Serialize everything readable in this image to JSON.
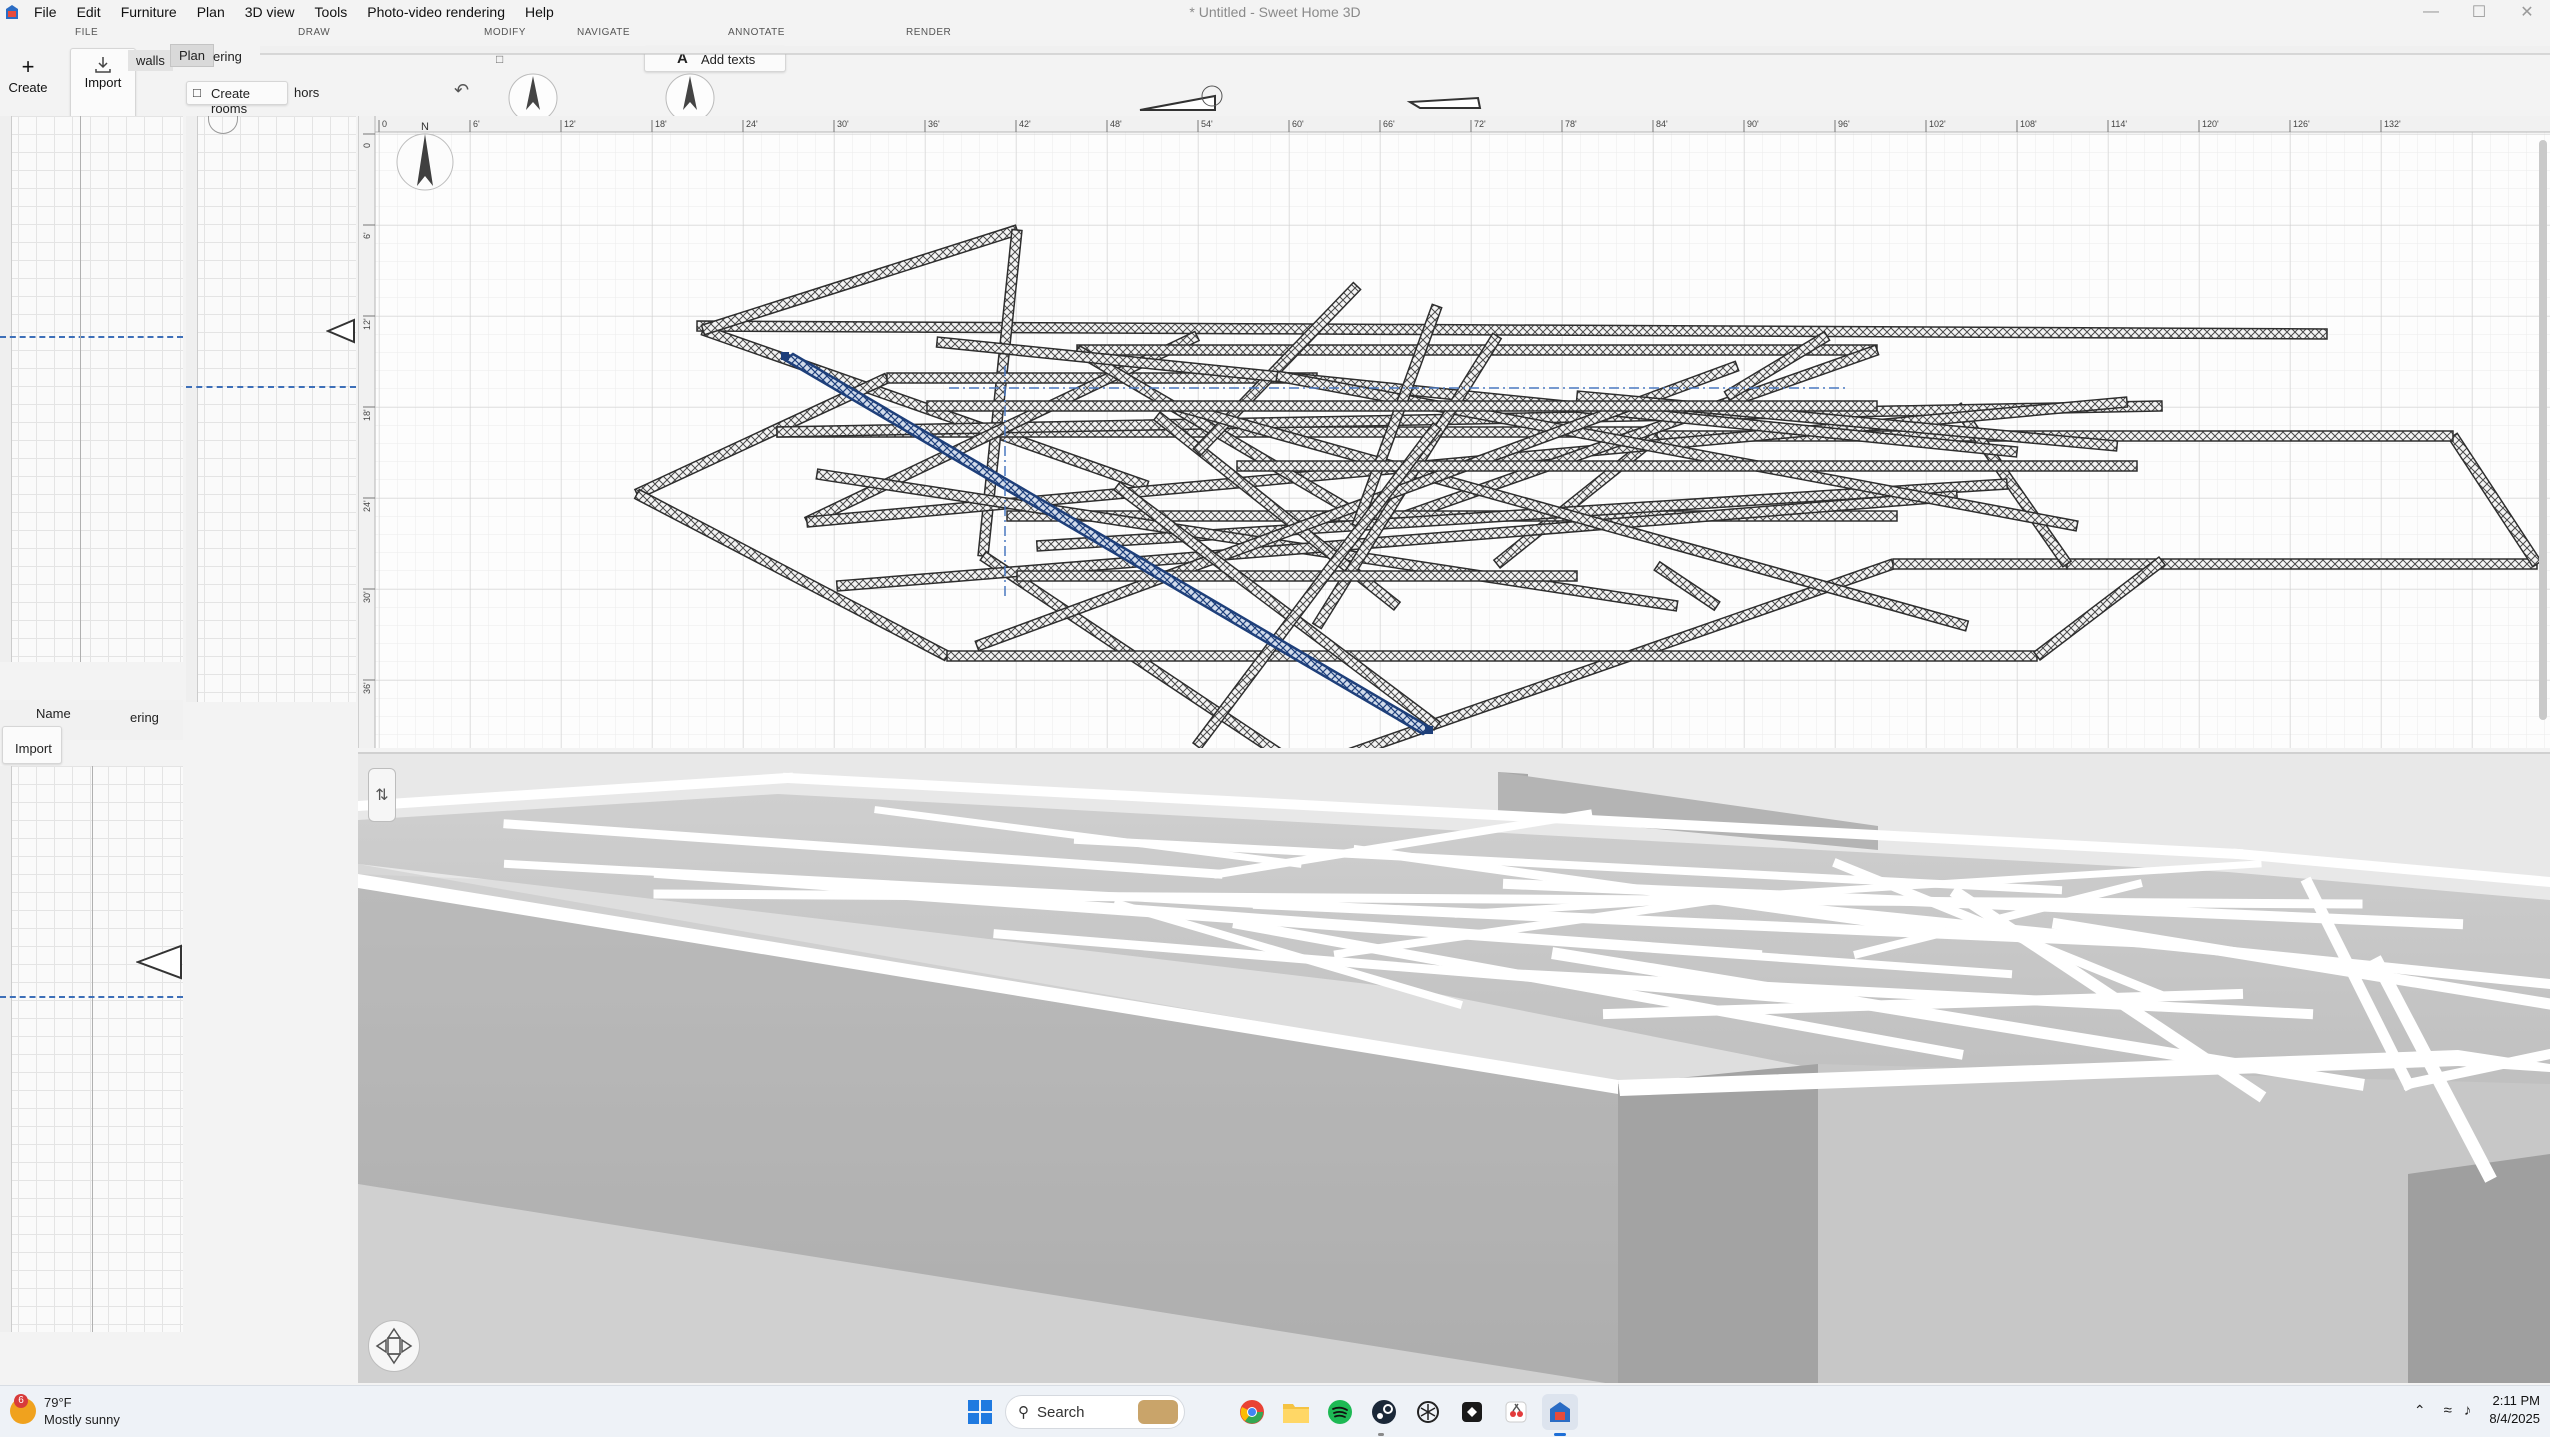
{
  "app": {
    "window_title": "* Untitled - Sweet Home 3D",
    "accent": "#1e3f7a"
  },
  "menu": [
    {
      "label": "File"
    },
    {
      "label": "Edit"
    },
    {
      "label": "Furniture"
    },
    {
      "label": "Plan"
    },
    {
      "label": "3D view"
    },
    {
      "label": "Tools"
    },
    {
      "label": "Photo-video rendering"
    },
    {
      "label": "Help"
    }
  ],
  "ribbon": {
    "groups": {
      "file": "FILE",
      "draw": "DRAW",
      "modify": "MODIFY",
      "navigate": "NAVIGATE",
      "annotate": "ANNOTATE",
      "render": "RENDER"
    },
    "create_label": "Create",
    "import_label": "Import",
    "walls_label": "walls",
    "plan_tab": "Plan",
    "rendering_tab": "ering",
    "create_rooms_label": "Create rooms",
    "anchors_label": "hors",
    "add_texts_label": "Add texts"
  },
  "ghost_panel": {
    "name_header": "Name",
    "import_label": "Import",
    "rendering_tab": "ering"
  },
  "plan": {
    "ruler_labels": [
      "0",
      "6'",
      "12'",
      "18'",
      "24'",
      "30'",
      "36'",
      "42'",
      "48'",
      "54'",
      "60'",
      "66'",
      "72'",
      "78'",
      "84'",
      "90'",
      "96'",
      "102'",
      "108'",
      "114'",
      "120'",
      "126'",
      "132'"
    ],
    "vertical_ruler_labels": [
      "0",
      "6'",
      "12'",
      "18'",
      "24'",
      "30'",
      "36'"
    ],
    "compass_letter": "N"
  },
  "view3d": {
    "nav_icon": "navigation-arrows-icon",
    "mode_icon": "virtual-visitor-icon"
  },
  "taskbar": {
    "weather_temp": "79°F",
    "weather_desc": "Mostly sunny",
    "weather_badge": "6",
    "search_label": "Search",
    "time": "2:11 PM",
    "date": "8/4/2025"
  }
}
